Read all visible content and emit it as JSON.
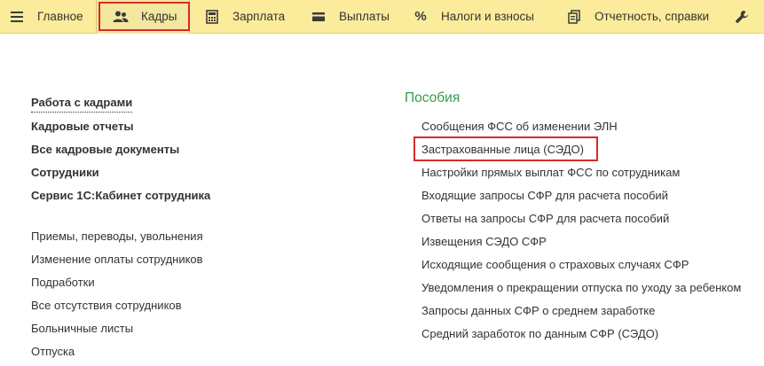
{
  "topbar": {
    "tabs": [
      {
        "label": "Главное",
        "icon": "hamburger-menu-icon"
      },
      {
        "label": "Кадры",
        "icon": "people-icon"
      },
      {
        "label": "Зарплата",
        "icon": "calculator-icon"
      },
      {
        "label": "Выплаты",
        "icon": "wallet-icon"
      },
      {
        "label": "Налоги и взносы",
        "icon": "percent-icon"
      },
      {
        "label": "Отчетность, справки",
        "icon": "documents-icon"
      },
      {
        "label": "",
        "icon": "wrench-icon"
      }
    ]
  },
  "left": {
    "bold_links": [
      "Работа с кадрами",
      "Кадровые отчеты",
      "Все кадровые документы",
      "Сотрудники",
      "Сервис 1С:Кабинет сотрудника"
    ],
    "links": [
      "Приемы, переводы, увольнения",
      "Изменение оплаты сотрудников",
      "Подработки",
      "Все отсутствия сотрудников",
      "Больничные листы",
      "Отпуска"
    ]
  },
  "benefits": {
    "title": "Пособия",
    "links": [
      "Сообщения ФСС об изменении ЭЛН",
      "Застрахованные лица (СЭДО)",
      "Настройки прямых выплат ФСС по сотрудникам",
      "Входящие запросы СФР для расчета пособий",
      "Ответы на запросы СФР для расчета пособий",
      "Извещения СЭДО СФР",
      "Исходящие сообщения о страховых случаях СФР",
      "Уведомления о прекращении отпуска по уходу за ребенком",
      "Запросы данных СФР о среднем заработке",
      "Средний заработок по данным СФР (СЭДО)"
    ]
  },
  "colors": {
    "topbar_bg": "#fbec9b",
    "highlight_red": "#d52b2b",
    "section_green": "#3a9a4a"
  }
}
